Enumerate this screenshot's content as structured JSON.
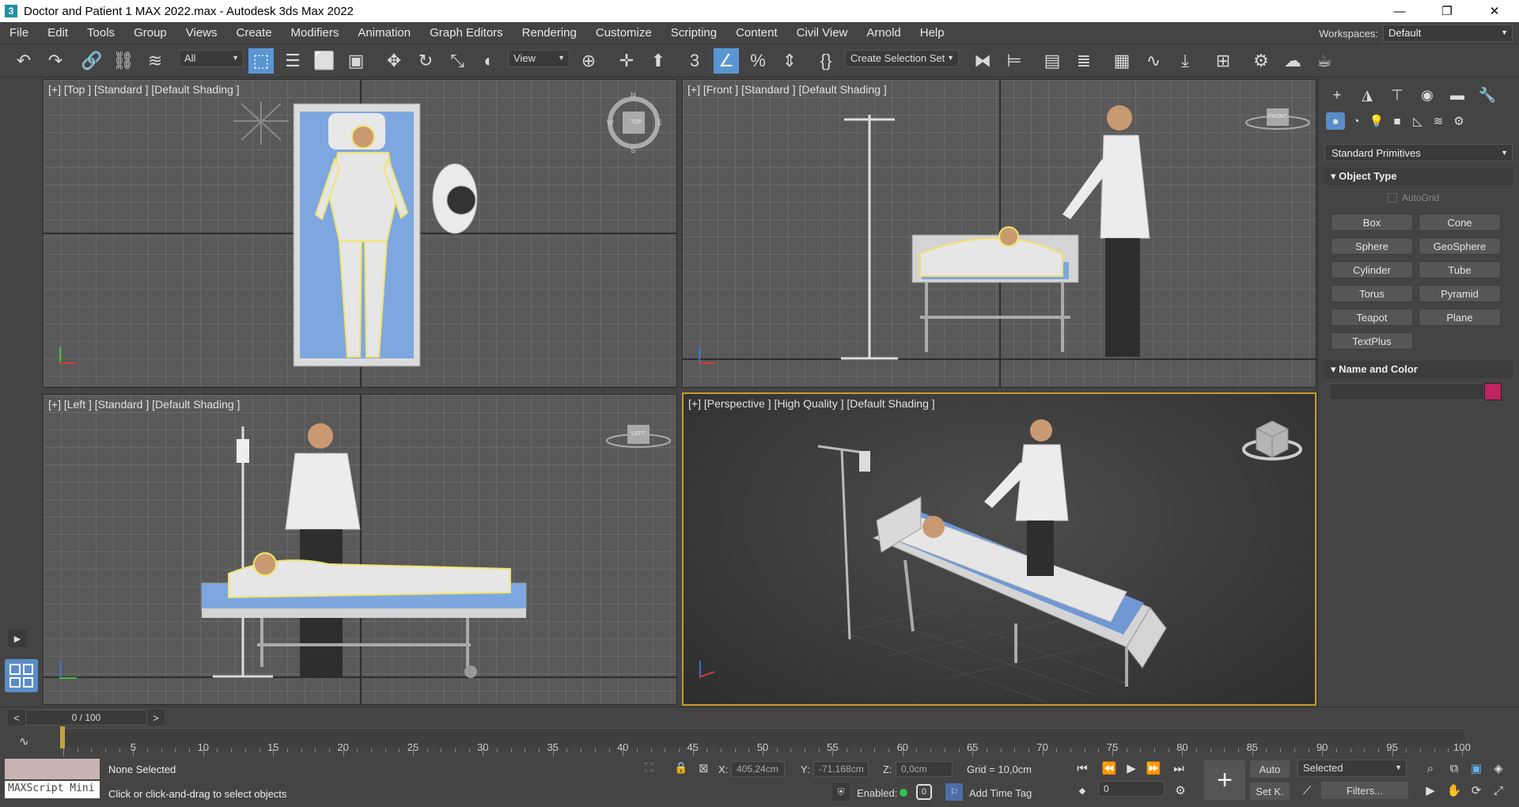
{
  "window": {
    "title": "Doctor and Patient 1 MAX 2022.max - Autodesk 3ds Max 2022",
    "app_icon": "3",
    "minimize": "—",
    "restore": "❐",
    "close": "✕"
  },
  "menu": [
    "File",
    "Edit",
    "Tools",
    "Group",
    "Views",
    "Create",
    "Modifiers",
    "Animation",
    "Graph Editors",
    "Rendering",
    "Customize",
    "Scripting",
    "Content",
    "Civil View",
    "Arnold",
    "Help"
  ],
  "workspaces": {
    "label": "Workspaces:",
    "value": "Default"
  },
  "toolbar": {
    "filter": "All",
    "refcoord": "View",
    "selection_set": "Create Selection Set"
  },
  "viewports": {
    "top": "[+] [Top ] [Standard ] [Default Shading ]",
    "front": "[+] [Front ] [Standard ] [Default Shading ]",
    "left": "[+] [Left ] [Standard ] [Default Shading ]",
    "perspective": "[+] [Perspective ] [High Quality ] [Default Shading ]",
    "viewcube": {
      "top": "TOP",
      "front": "FRONT",
      "left": "LEFT",
      "n": "N",
      "s": "S",
      "e": "E",
      "w": "W"
    }
  },
  "command_panel": {
    "category": "Standard Primitives",
    "object_type": {
      "title": "Object Type",
      "autogrid": "AutoGrid",
      "buttons": [
        "Box",
        "Cone",
        "Sphere",
        "GeoSphere",
        "Cylinder",
        "Tube",
        "Torus",
        "Pyramid",
        "Teapot",
        "Plane",
        "TextPlus"
      ]
    },
    "name_color": {
      "title": "Name and Color",
      "name_value": "",
      "color": "#c0245e"
    }
  },
  "timeline": {
    "frame": "0 / 100",
    "prev": "<",
    "next": ">",
    "ticks": [
      "5",
      "10",
      "15",
      "20",
      "25",
      "30",
      "35",
      "40",
      "45",
      "50",
      "55",
      "60",
      "65",
      "70",
      "75",
      "80",
      "85",
      "90",
      "95",
      "100"
    ]
  },
  "status": {
    "selection": "None Selected",
    "prompt": "Click or click-and-drag to select objects",
    "maxscript": "MAXScript Mini",
    "x_label": "X:",
    "x_value": "405,24cm",
    "y_label": "Y:",
    "y_value": "-71,168cm",
    "z_label": "Z:",
    "z_value": "0,0cm",
    "grid": "Grid = 10,0cm",
    "enabled_label": "Enabled:",
    "enabled_value": "0",
    "add_time_tag": "Add Time Tag",
    "auto": "Auto",
    "setkey": "Set K.",
    "key_filter": "Selected",
    "filters": "Filters...",
    "frame_field": "0"
  }
}
